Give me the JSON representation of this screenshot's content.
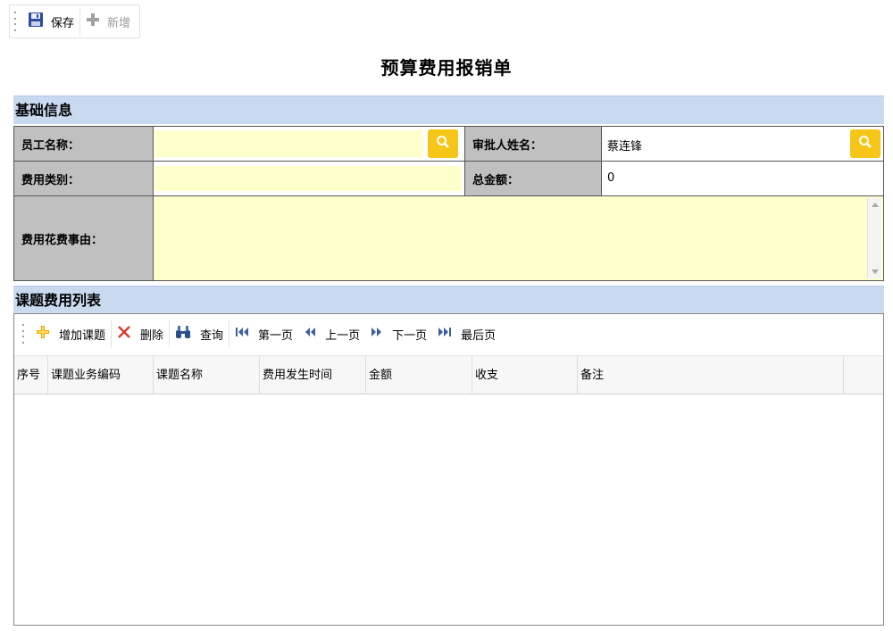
{
  "toolbar": {
    "save_label": "保存",
    "add_label": "新增"
  },
  "page_title": "预算费用报销单",
  "basic_section": {
    "title": "基础信息",
    "employee_name_label": "员工名称：",
    "employee_name_value": "",
    "approver_name_label": "审批人姓名：",
    "approver_name_value": "蔡连锋",
    "expense_type_label": "费用类别：",
    "expense_type_value": "",
    "total_amount_label": "总金额：",
    "total_amount_value": "0",
    "reason_label": "费用花费事由：",
    "reason_value": ""
  },
  "list_section": {
    "title": "课题费用列表",
    "toolbar": {
      "add": "增加课题",
      "delete": "删除",
      "query": "查询",
      "first": "第一页",
      "prev": "上一页",
      "next": "下一页",
      "last": "最后页"
    },
    "columns": [
      "序号",
      "课题业务编码",
      "课题名称",
      "费用发生时间",
      "金额",
      "收支",
      "备注"
    ],
    "rows": []
  },
  "colors": {
    "section_bar": "#c9daf0",
    "label_bg": "#c0c0c0",
    "field_bg": "#ffffcc",
    "search_button": "#f5c518"
  }
}
